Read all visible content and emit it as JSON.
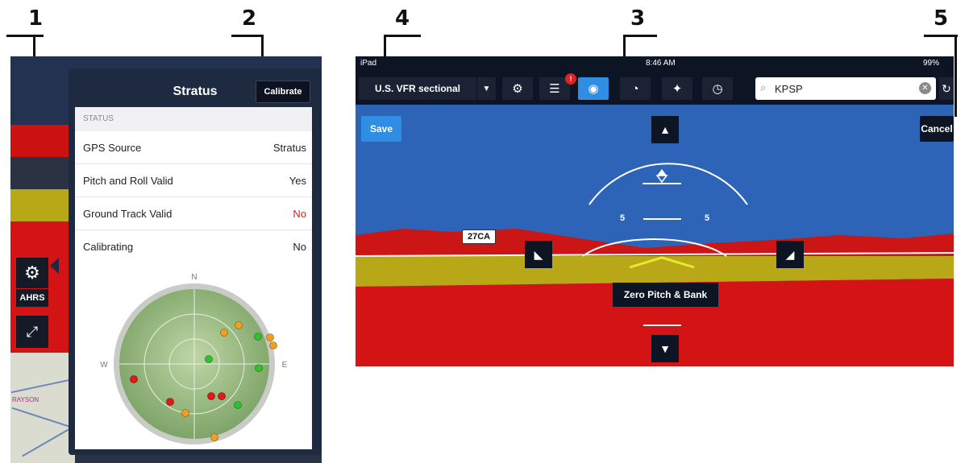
{
  "callouts": [
    "1",
    "2",
    "3",
    "4",
    "5"
  ],
  "left": {
    "panel_title": "Stratus",
    "calibrate_label": "Calibrate",
    "status_header": "STATUS",
    "rows": [
      {
        "label": "GPS Source",
        "value": "Stratus"
      },
      {
        "label": "Pitch and Roll Valid",
        "value": "Yes"
      },
      {
        "label": "Ground Track Valid",
        "value": "No"
      },
      {
        "label": "Calibrating",
        "value": "No"
      }
    ],
    "ahrs_label": "AHRS",
    "compass": {
      "n": "N",
      "e": "E",
      "w": "W"
    },
    "map_label": "RAYSON",
    "colors": {
      "green": "#2fbf2f",
      "orange": "#f0a020",
      "red": "#e01919"
    }
  },
  "right": {
    "status": {
      "device": "iPad",
      "time": "8:46 AM",
      "battery": "99%"
    },
    "chart_select": "U.S. VFR sectional",
    "badge": "!",
    "search_value": "KPSP",
    "save_label": "Save",
    "cancel_label": "Cancel",
    "zero_label": "Zero Pitch & Bank",
    "waypoint": "27CA",
    "pitch_left": "5",
    "pitch_right": "5"
  }
}
